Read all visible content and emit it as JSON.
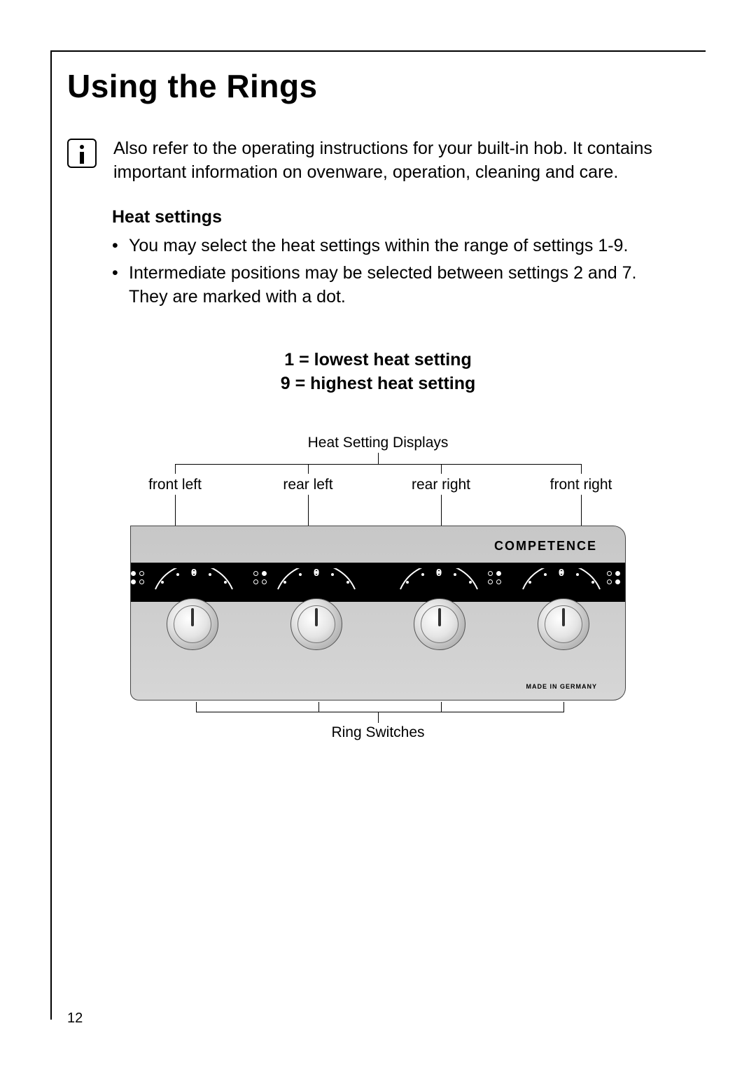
{
  "page_number": "12",
  "title": "Using the Rings",
  "info_paragraph": "Also refer to the operating instructions for your built-in hob. It contains important information on ovenware, operation, cleaning and care.",
  "heat_settings": {
    "heading": "Heat settings",
    "bullets": [
      "You may select the heat settings within the range of settings 1-9.",
      "Intermediate positions may be selected between settings 2 and 7. They are marked with a dot."
    ]
  },
  "legend": {
    "line1": "1 = lowest heat setting",
    "line2": "9 = highest heat setting"
  },
  "diagram": {
    "top_label": "Heat Setting Displays",
    "positions": [
      "front left",
      "rear left",
      "rear right",
      "front right"
    ],
    "brand": "COMPETENCE",
    "zero_label": "0",
    "made_in": "MADE IN GERMANY",
    "bottom_label": "Ring Switches"
  }
}
